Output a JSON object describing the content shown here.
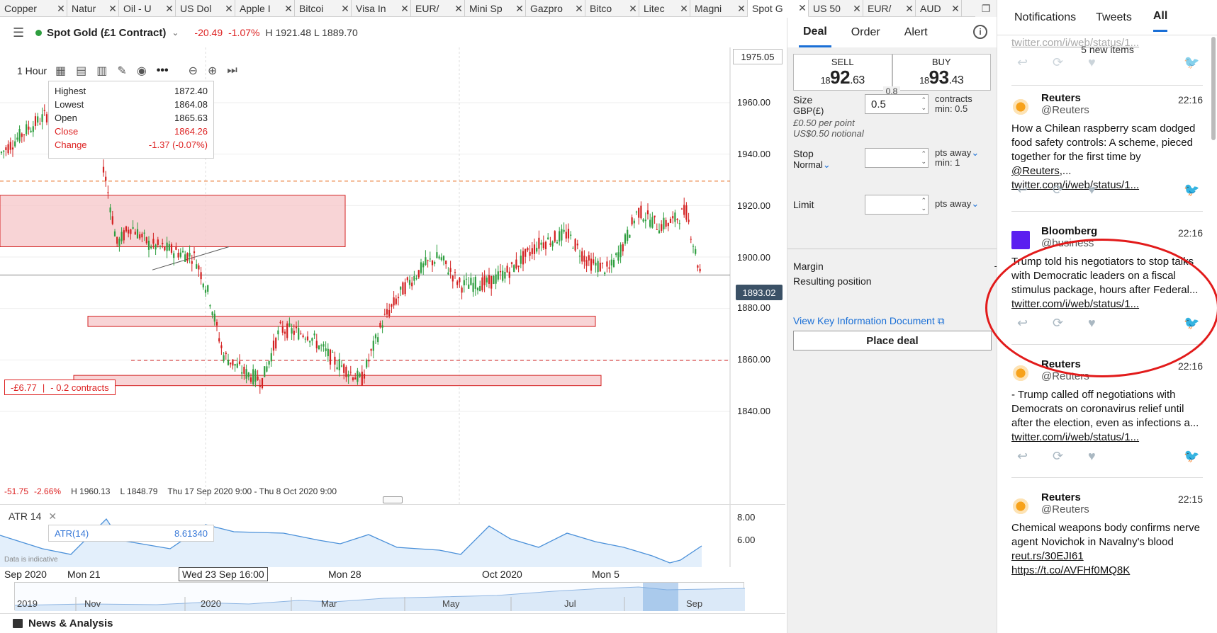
{
  "tabs": [
    {
      "label": "Copper",
      "w": 95
    },
    {
      "label": "Natur",
      "w": 73
    },
    {
      "label": "Oil - U",
      "w": 80
    },
    {
      "label": "US Dol",
      "w": 84
    },
    {
      "label": "Apple I",
      "w": 84
    },
    {
      "label": "Bitcoi",
      "w": 80
    },
    {
      "label": "Visa In",
      "w": 84
    },
    {
      "label": "EUR/",
      "w": 76
    },
    {
      "label": "Mini Sp",
      "w": 86
    },
    {
      "label": "Gazpro",
      "w": 84
    },
    {
      "label": "Bitco",
      "w": 76
    },
    {
      "label": "Litec",
      "w": 72
    },
    {
      "label": "Magni",
      "w": 81
    },
    {
      "label": "Spot G",
      "w": 86,
      "active": true
    },
    {
      "label": "US 50",
      "w": 77
    },
    {
      "label": "EUR/",
      "w": 74
    },
    {
      "label": "AUD",
      "w": 65
    }
  ],
  "tab_window_icon": "restore-window-icon",
  "chart": {
    "instrument": "Spot Gold (£1 Contract)",
    "change": "-20.49",
    "change_pct": "-1.07%",
    "hl": "H 1921.48  L 1889.70",
    "timeframe": "1 Hour",
    "ohlc": {
      "highest_label": "Highest",
      "highest": "1872.40",
      "lowest_label": "Lowest",
      "lowest": "1864.08",
      "open_label": "Open",
      "open": "1865.63",
      "close_label": "Close",
      "close": "1864.26",
      "change_label": "Change",
      "change": "-1.37 (-0.07%)"
    },
    "top_price": "1975.05",
    "last_price": "1893.02",
    "price_labels": [
      "1960.00",
      "1940.00",
      "1920.00",
      "1900.00",
      "1880.00",
      "1860.00",
      "1840.00"
    ],
    "position": {
      "pnl": "-£6.77",
      "size": "- 0.2 contracts"
    },
    "range": {
      "change": "-51.75",
      "pct": "-2.66%",
      "high": "H 1960.13",
      "low": "L 1848.79",
      "period": "Thu 17 Sep 2020 9:00 - Thu 8 Oct 2020 9:00"
    },
    "colors": {
      "up": "#2e9e3f",
      "down": "#d32020",
      "zone": "#f5c6c8",
      "zone_border": "#d32020",
      "atr": "#4a90d9"
    }
  },
  "atr": {
    "title": "ATR  14",
    "box_label": "ATR(14)",
    "box_value": "8.61340",
    "ticks": [
      "8.00",
      "6.00"
    ],
    "disclaimer": "Data is indicative"
  },
  "date_axis": {
    "labels": [
      "Sep 2020",
      "Mon 21",
      "Mon 28",
      "Oct 2020",
      "Mon 5"
    ],
    "crosshair": "Wed 23 Sep 16:00"
  },
  "navigator": {
    "labels": [
      "2019",
      "Nov",
      "2020",
      "Mar",
      "May",
      "Jul",
      "Sep"
    ]
  },
  "news": {
    "label": "News & Analysis"
  },
  "deal": {
    "tabs": [
      "Deal",
      "Order",
      "Alert"
    ],
    "sell_label": "SELL",
    "sell_prefix": "18",
    "sell_big": "92",
    "sell_small": ".63",
    "buy_label": "BUY",
    "buy_prefix": "18",
    "buy_big": "93",
    "buy_small": ".43",
    "spread": "0.8",
    "size_label": "Size",
    "size_currency": "GBP(£)",
    "size_value": "0.5",
    "size_unit": "contracts",
    "size_min": "min: 0.5",
    "per_point": "£0.50 per point",
    "notional": "US$0.50 notional",
    "stop_label": "Stop",
    "stop_type": "Normal",
    "stop_unit": "pts away",
    "stop_min": "min: 1",
    "limit_label": "Limit",
    "limit_unit": "pts away",
    "margin_label": "Margin",
    "margin_value": "-",
    "resulting_label": "Resulting position",
    "resulting_value": "-",
    "kid_link": "View Key Information Document",
    "place_deal": "Place deal"
  },
  "twitter": {
    "tabs": [
      "Notifications",
      "Tweets",
      "All"
    ],
    "new_items": "5 new items",
    "partial_link": "twitter.com/i/web/status/1...",
    "tweets": [
      {
        "name": "Reuters",
        "handle": "@Reuters",
        "time": "22:16",
        "text": "How a Chilean raspberry scam dodged food safety controls: A scheme, pieced together for the first time by ",
        "mention": "@Reuters",
        "text2": ",...",
        "link": "twitter.com/i/web/status/1...",
        "avatar": "reuters"
      },
      {
        "name": "Bloomberg",
        "handle": "@business",
        "time": "22:16",
        "text": "Trump told his negotiators to stop talks with Democratic leaders on a fiscal stimulus package, hours after Federal...",
        "link": "twitter.com/i/web/status/1...",
        "avatar": "bloomberg"
      },
      {
        "name": "Reuters",
        "handle": "@Reuters",
        "time": "22:16",
        "text": "- Trump called off negotiations with Democrats on coronavirus relief until after the election, even as infections a...",
        "link": "twitter.com/i/web/status/1...",
        "avatar": "reuters"
      },
      {
        "name": "Reuters",
        "handle": "@Reuters",
        "time": "22:15",
        "text": "Chemical weapons body confirms nerve agent Novichok in Navalny's blood ",
        "mention": "reut.rs/30EJI61",
        "link": "https://t.co/AVFHf0MQ8K",
        "avatar": "reuters"
      }
    ]
  }
}
